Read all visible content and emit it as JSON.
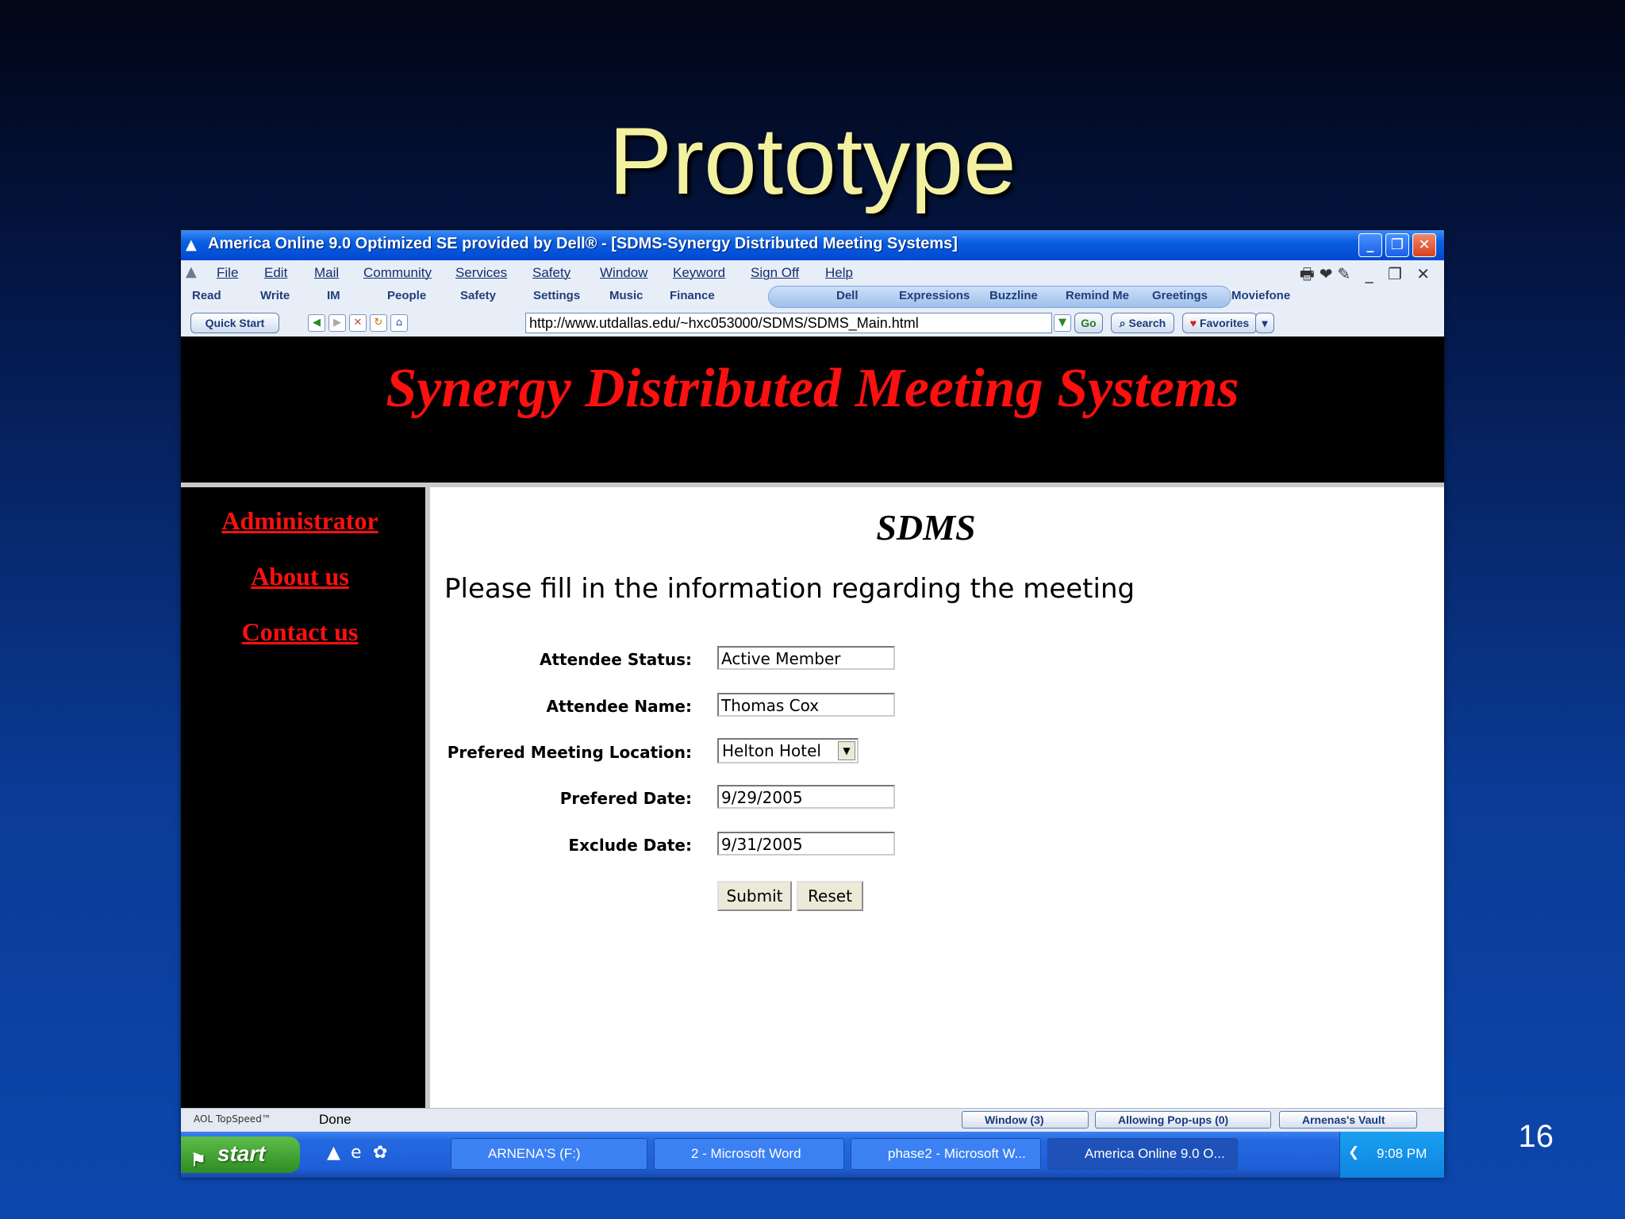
{
  "slide": {
    "title": "Prototype",
    "page_number": "16"
  },
  "window": {
    "title": "America Online 9.0 Optimized SE provided by Dell® - [SDMS-Synergy Distributed Meeting Systems]"
  },
  "menu": [
    "File",
    "Edit",
    "Mail",
    "Community",
    "Services",
    "Safety",
    "Window",
    "Keyword",
    "Sign Off",
    "Help"
  ],
  "toolbar": {
    "left": [
      "Read",
      "Write",
      "IM",
      "People",
      "Safety",
      "Settings",
      "Music",
      "Finance"
    ],
    "right": [
      "Dell",
      "Expressions",
      "Buzzline",
      "Remind Me",
      "Greetings",
      "Moviefone"
    ]
  },
  "addressbar": {
    "quick_start": "Quick Start",
    "url": "http://www.utdallas.edu/~hxc053000/SDMS/SDMS_Main.html",
    "go": "Go",
    "search": "Search",
    "favorites": "Favorites"
  },
  "page": {
    "banner": "Synergy Distributed Meeting Systems",
    "nav": [
      "Administrator",
      "About us",
      "Contact us"
    ],
    "heading": "SDMS",
    "intro": "Please fill in the information regarding the meeting",
    "form": {
      "status_label": "Attendee Status:",
      "status_value": "Active Member",
      "name_label": "Attendee Name:",
      "name_value": "Thomas Cox",
      "location_label": "Prefered Meeting Location:",
      "location_value": "Helton Hotel",
      "date_label": "Prefered Date:",
      "date_value": "9/29/2005",
      "exclude_label": "Exclude Date:",
      "exclude_value": "9/31/2005",
      "submit": "Submit",
      "reset": "Reset"
    }
  },
  "statusbar": {
    "topspeed": "AOL TopSpeed™",
    "status": "Done",
    "window_btn": "Window (3)",
    "popups_btn": "Allowing Pop-ups (0)",
    "vault_btn": "Arnenas's Vault"
  },
  "taskbar": {
    "start": "start",
    "tasks": [
      "ARNENA'S (F:)",
      "2 - Microsoft Word",
      "phase2 - Microsoft W...",
      "America Online 9.0 O..."
    ],
    "time": "9:08 PM"
  }
}
